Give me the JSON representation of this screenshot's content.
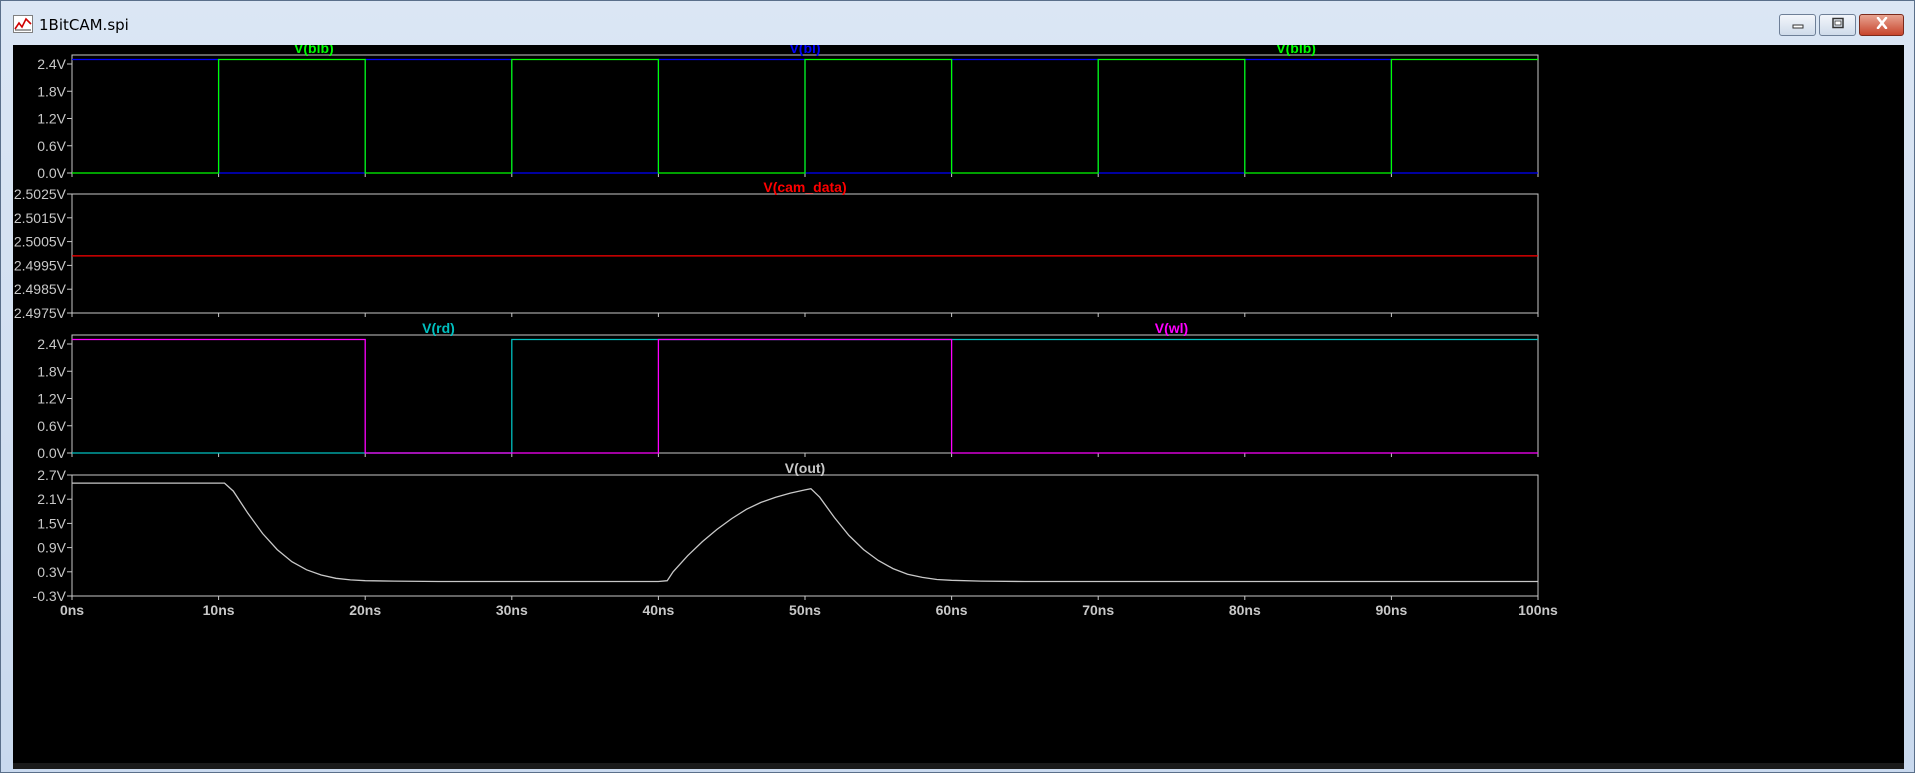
{
  "window": {
    "title": "1BitCAM.spi",
    "controls": {
      "minimize": "minimize-icon",
      "maximize": "maximize-icon",
      "close": "close-icon"
    }
  },
  "colors": {
    "background": "#000000",
    "frame": "#c8c8c8",
    "axis_text": "#c8c8c8",
    "blb": "#00ff00",
    "bl": "#0000ff",
    "cam_data": "#ff0000",
    "rd": "#00c0c0",
    "wl": "#ff00ff",
    "out": "#c8c8c8"
  },
  "chart_data": [
    {
      "type": "line",
      "x_unit": "ns",
      "xlim": [
        0,
        100
      ],
      "ylim": [
        0,
        2.7
      ],
      "yticks": [
        "2.4V",
        "1.8V",
        "1.2V",
        "0.6V",
        "0.0V"
      ],
      "ytick_values": [
        2.4,
        1.8,
        1.2,
        0.6,
        0.0
      ],
      "trace_labels": [
        {
          "text": "V(blb)",
          "color": "#00ff00",
          "pos": "left"
        },
        {
          "text": "V(bl)",
          "color": "#0000ff",
          "pos": "center"
        },
        {
          "text": "V(blb)",
          "color": "#00ff00",
          "pos": "right"
        }
      ],
      "series": [
        {
          "name": "V(bl)",
          "color": "#0000ff",
          "x": [
            0,
            10,
            10,
            20,
            20,
            30,
            30,
            40,
            40,
            50,
            50,
            60,
            60,
            70,
            70,
            80,
            80,
            90,
            90,
            100
          ],
          "y": [
            2.5,
            2.5,
            0,
            0,
            2.5,
            2.5,
            0,
            0,
            2.5,
            2.5,
            0,
            0,
            2.5,
            2.5,
            0,
            0,
            2.5,
            2.5,
            0,
            0
          ]
        },
        {
          "name": "V(blb)",
          "color": "#00ff00",
          "x": [
            0,
            10,
            10,
            20,
            20,
            30,
            30,
            40,
            40,
            50,
            50,
            60,
            60,
            70,
            70,
            80,
            80,
            90,
            90,
            100
          ],
          "y": [
            0,
            0,
            2.5,
            2.5,
            0,
            0,
            2.5,
            2.5,
            0,
            0,
            2.5,
            2.5,
            0,
            0,
            2.5,
            2.5,
            0,
            0,
            2.5,
            2.5
          ]
        }
      ]
    },
    {
      "type": "line",
      "x_unit": "ns",
      "xlim": [
        0,
        100
      ],
      "ylim": [
        2.4975,
        2.5025
      ],
      "yticks": [
        "2.5025V",
        "2.5015V",
        "2.5005V",
        "2.4995V",
        "2.4985V",
        "2.4975V"
      ],
      "ytick_values": [
        2.5025,
        2.5015,
        2.5005,
        2.4995,
        2.4985,
        2.4975
      ],
      "trace_labels": [
        {
          "text": "V(cam_data)",
          "color": "#ff0000",
          "pos": "center"
        }
      ],
      "series": [
        {
          "name": "V(cam_data)",
          "color": "#ff0000",
          "x": [
            0,
            100
          ],
          "y": [
            2.4999,
            2.4999
          ]
        }
      ]
    },
    {
      "type": "line",
      "x_unit": "ns",
      "xlim": [
        0,
        100
      ],
      "ylim": [
        0,
        2.7
      ],
      "yticks": [
        "2.4V",
        "1.8V",
        "1.2V",
        "0.6V",
        "0.0V"
      ],
      "ytick_values": [
        2.4,
        1.8,
        1.2,
        0.6,
        0.0
      ],
      "trace_labels": [
        {
          "text": "V(rd)",
          "color": "#00c0c0",
          "pos": "left"
        },
        {
          "text": "V(wl)",
          "color": "#ff00ff",
          "pos": "right"
        }
      ],
      "series": [
        {
          "name": "V(rd)",
          "color": "#00c0c0",
          "x": [
            0,
            30,
            30,
            100
          ],
          "y": [
            0,
            0,
            2.5,
            2.5
          ]
        },
        {
          "name": "V(wl)",
          "color": "#ff00ff",
          "x": [
            0,
            20,
            20,
            40,
            40,
            60,
            60,
            100
          ],
          "y": [
            2.5,
            2.5,
            0,
            0,
            2.5,
            2.5,
            0,
            0
          ]
        }
      ]
    },
    {
      "type": "line",
      "x_unit": "ns",
      "xlim": [
        0,
        100
      ],
      "ylim": [
        -0.3,
        2.7
      ],
      "yticks": [
        "2.7V",
        "2.1V",
        "1.5V",
        "0.9V",
        "0.3V",
        "-0.3V"
      ],
      "ytick_values": [
        2.7,
        2.1,
        1.5,
        0.9,
        0.3,
        -0.3
      ],
      "xticks": [
        "0ns",
        "10ns",
        "20ns",
        "30ns",
        "40ns",
        "50ns",
        "60ns",
        "70ns",
        "80ns",
        "90ns",
        "100ns"
      ],
      "xtick_values": [
        0,
        10,
        20,
        30,
        40,
        50,
        60,
        70,
        80,
        90,
        100
      ],
      "trace_labels": [
        {
          "text": "V(out)",
          "color": "#c8c8c8",
          "pos": "center"
        }
      ],
      "series": [
        {
          "name": "V(out)",
          "color": "#c8c8c8",
          "x": [
            0,
            10.4,
            11,
            12,
            13,
            14,
            15,
            16,
            17,
            18,
            19,
            20,
            22,
            25,
            30,
            35,
            40,
            40.6,
            41,
            42,
            43,
            44,
            45,
            46,
            47,
            48,
            49,
            50,
            50.4,
            51,
            52,
            53,
            54,
            55,
            56,
            57,
            58,
            59,
            60,
            62,
            65,
            70,
            80,
            90,
            100
          ],
          "y": [
            2.5,
            2.5,
            2.3,
            1.75,
            1.25,
            0.85,
            0.55,
            0.35,
            0.22,
            0.14,
            0.1,
            0.08,
            0.07,
            0.06,
            0.06,
            0.06,
            0.06,
            0.08,
            0.3,
            0.7,
            1.05,
            1.35,
            1.62,
            1.85,
            2.02,
            2.15,
            2.25,
            2.33,
            2.36,
            2.15,
            1.65,
            1.2,
            0.85,
            0.58,
            0.38,
            0.24,
            0.16,
            0.11,
            0.09,
            0.07,
            0.06,
            0.06,
            0.06,
            0.06,
            0.06
          ]
        }
      ]
    }
  ]
}
